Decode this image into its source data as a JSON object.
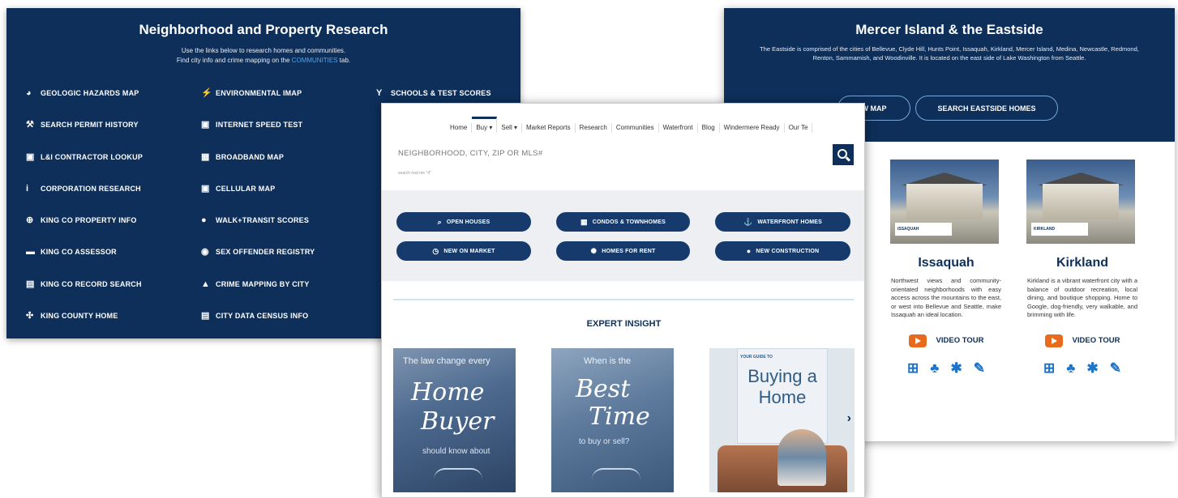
{
  "left_panel": {
    "title": "Neighborhood and Property Research",
    "intro_line1": "Use the links below to research homes and communities.",
    "intro_line2_pre": "Find city info and crime mapping on the ",
    "intro_link": "COMMUNITIES",
    "intro_line2_post": " tab.",
    "col1": [
      {
        "icon": "◕",
        "label": "GEOLOGIC HAZARDS MAP"
      },
      {
        "icon": "⚒",
        "label": "SEARCH PERMIT HISTORY"
      },
      {
        "icon": "▣",
        "label": "L&I CONTRACTOR LOOKUP"
      },
      {
        "icon": "i",
        "label": "CORPORATION RESEARCH"
      },
      {
        "icon": "⊕",
        "label": "KING CO PROPERTY INFO"
      },
      {
        "icon": "▬",
        "label": "KING CO ASSESSOR"
      },
      {
        "icon": "▤",
        "label": "KING CO RECORD SEARCH"
      },
      {
        "icon": "✣",
        "label": "KING COUNTY HOME"
      }
    ],
    "col2": [
      {
        "icon": "⚡",
        "label": "ENVIRONMENTAL IMAP"
      },
      {
        "icon": "▣",
        "label": "INTERNET SPEED TEST"
      },
      {
        "icon": "▦",
        "label": "BROADBAND MAP"
      },
      {
        "icon": "▣",
        "label": "CELLULAR MAP"
      },
      {
        "icon": "●",
        "label": "WALK+TRANSIT SCORES"
      },
      {
        "icon": "◉",
        "label": "SEX OFFENDER REGISTRY"
      },
      {
        "icon": "▲",
        "label": "CRIME MAPPING BY CITY"
      },
      {
        "icon": "▤",
        "label": "CITY DATA CENSUS INFO"
      }
    ],
    "col3": [
      {
        "icon": "Y",
        "label": "SCHOOLS & TEST SCORES"
      }
    ]
  },
  "right_panel": {
    "title": "Mercer Island & the Eastside",
    "desc": "The Eastside is comprised of the cities of Bellevue, Clyde Hill, Hunts Point, Issaquah, Kirkland, Mercer Island, Medina, Newcastle, Redmond, Renton, Sammamish, and Woodinville. It is located on the east side of Lake Washington from Seattle.",
    "btn_map": "W MAP",
    "btn_search": "SEARCH EASTSIDE HOMES",
    "cities": [
      {
        "name": "Issaquah",
        "tag": "ISSAQUAH",
        "text": "Northwest views and community-orientated neighborhoods with easy access across the mountains to the east, or west into Bellevue and Seattle, make Issaquah an ideal location.",
        "video": "VIDEO TOUR"
      },
      {
        "name": "Kirkland",
        "tag": "KIRKLAND",
        "text": "Kirkland is a vibrant waterfront city with a balance of outdoor recreation, local dining, and boutique shopping. Home to Google, dog-friendly, very walkable, and brimming with life.",
        "video": "VIDEO TOUR"
      }
    ]
  },
  "center_panel": {
    "nav": [
      "Home",
      "Buy ▾",
      "Sell ▾",
      "Market Reports",
      "Research",
      "Communities",
      "Waterfront",
      "Blog",
      "Windermere Ready",
      "Our Te"
    ],
    "search_placeholder": "NEIGHBORHOOD, CITY, ZIP OR MLS#",
    "search_hint": "search real me \"4\"",
    "quick_buttons": [
      {
        "icon": "⌕",
        "label": "OPEN HOUSES"
      },
      {
        "icon": "▦",
        "label": "CONDOS & TOWNHOMES"
      },
      {
        "icon": "⚓",
        "label": "WATERFRONT HOMES"
      },
      {
        "icon": "◷",
        "label": "NEW ON MARKET"
      },
      {
        "icon": "✺",
        "label": "HOMES FOR RENT"
      },
      {
        "icon": "●",
        "label": "NEW CONSTRUCTION"
      }
    ],
    "insight_title": "EXPERT INSIGHT",
    "cards": {
      "k1_top": "The law change every",
      "k1_script1": "Home",
      "k1_script2": "Buyer",
      "k1_bottom": "should know about",
      "k2_top": "When is the",
      "k2_script1": "Best",
      "k2_script2": "Time",
      "k2_bottom": "to buy or sell?",
      "k3_kicker": "YOUR GUIDE TO",
      "k3_big": "Buying a Home",
      "next": "›"
    }
  }
}
